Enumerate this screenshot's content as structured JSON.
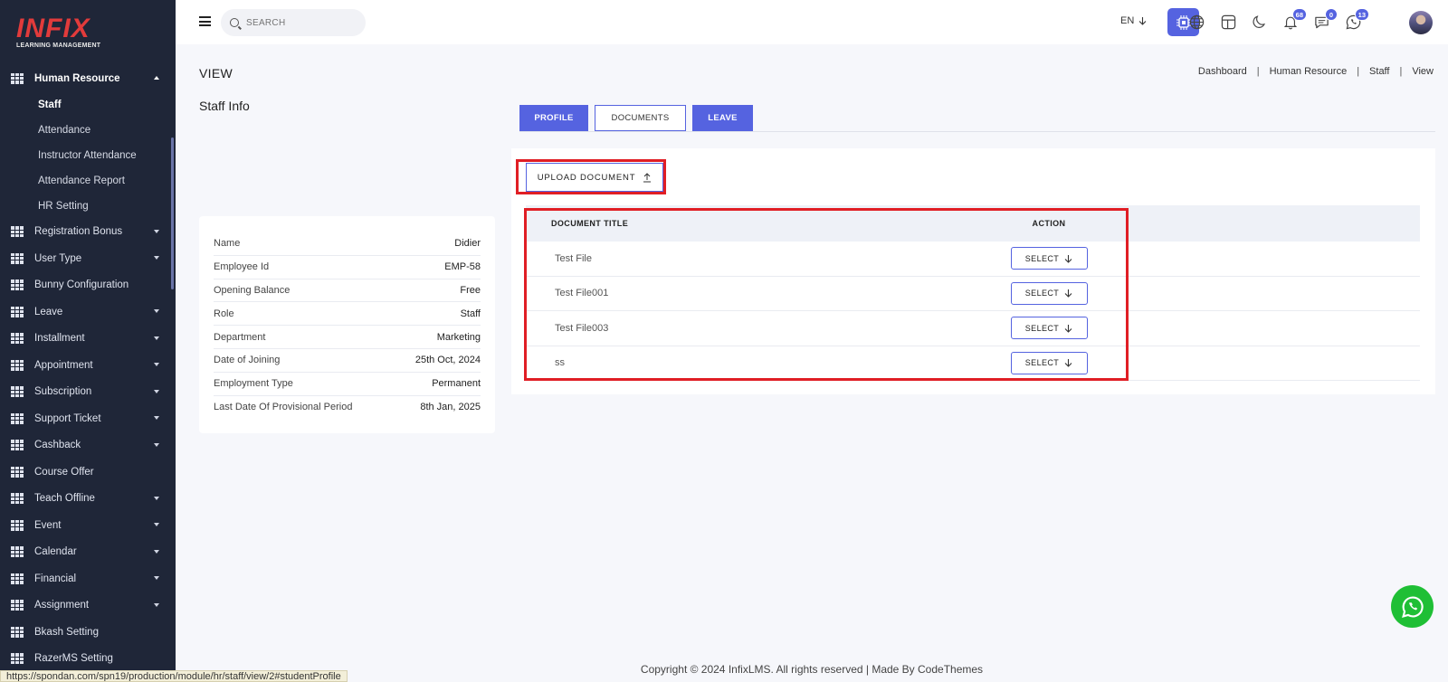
{
  "logo": {
    "main": "INFIX",
    "sub": "LEARNING MANAGEMENT"
  },
  "sidebar": {
    "open_group": "Human Resource",
    "sub_items": [
      "Staff",
      "Attendance",
      "Instructor Attendance",
      "Attendance Report",
      "HR Setting"
    ],
    "items": [
      {
        "label": "Registration Bonus",
        "caret": true
      },
      {
        "label": "User Type",
        "caret": true
      },
      {
        "label": "Bunny Configuration",
        "caret": false
      },
      {
        "label": "Leave",
        "caret": true
      },
      {
        "label": "Installment",
        "caret": true
      },
      {
        "label": "Appointment",
        "caret": true
      },
      {
        "label": "Subscription",
        "caret": true
      },
      {
        "label": "Support Ticket",
        "caret": true
      },
      {
        "label": "Cashback",
        "caret": true
      },
      {
        "label": "Course Offer",
        "caret": false
      },
      {
        "label": "Teach Offline",
        "caret": true
      },
      {
        "label": "Event",
        "caret": true
      },
      {
        "label": "Calendar",
        "caret": true
      },
      {
        "label": "Financial",
        "caret": true
      },
      {
        "label": "Assignment",
        "caret": true
      },
      {
        "label": "Bkash Setting",
        "caret": false
      },
      {
        "label": "RazerMS Setting",
        "caret": false
      }
    ]
  },
  "topbar": {
    "search_placeholder": "SEARCH",
    "language": "EN",
    "notifications_count": "68",
    "messages_count": "0",
    "whatsapp_count": "13",
    "accent_color": "#5563e0"
  },
  "page": {
    "title": "VIEW",
    "breadcrumb": [
      "Dashboard",
      "Human Resource",
      "Staff",
      "View"
    ],
    "section_title": "Staff Info"
  },
  "staff_info": [
    {
      "label": "Name",
      "value": "Didier"
    },
    {
      "label": "Employee Id",
      "value": "EMP-58"
    },
    {
      "label": "Opening Balance",
      "value": "Free"
    },
    {
      "label": "Role",
      "value": "Staff"
    },
    {
      "label": "Department",
      "value": "Marketing"
    },
    {
      "label": "Date of Joining",
      "value": "25th Oct, 2024"
    },
    {
      "label": "Employment Type",
      "value": "Permanent"
    },
    {
      "label": "Last Date Of Provisional Period",
      "value": "8th Jan, 2025"
    }
  ],
  "tabs": [
    {
      "label": "PROFILE",
      "active": false
    },
    {
      "label": "DOCUMENTS",
      "active": true
    },
    {
      "label": "LEAVE",
      "active": false
    }
  ],
  "documents": {
    "upload_label": "UPLOAD DOCUMENT",
    "columns": [
      "DOCUMENT TITLE",
      "ACTION"
    ],
    "rows": [
      {
        "title": "Test File",
        "action": "SELECT"
      },
      {
        "title": "Test File001",
        "action": "SELECT"
      },
      {
        "title": "Test File003",
        "action": "SELECT"
      },
      {
        "title": "ss",
        "action": "SELECT"
      }
    ]
  },
  "footer": {
    "text": "Copyright © 2024 InfixLMS. All rights reserved | Made By CodeThemes"
  },
  "status_url": "https://spondan.com/spn19/production/module/hr/staff/view/2#studentProfile"
}
